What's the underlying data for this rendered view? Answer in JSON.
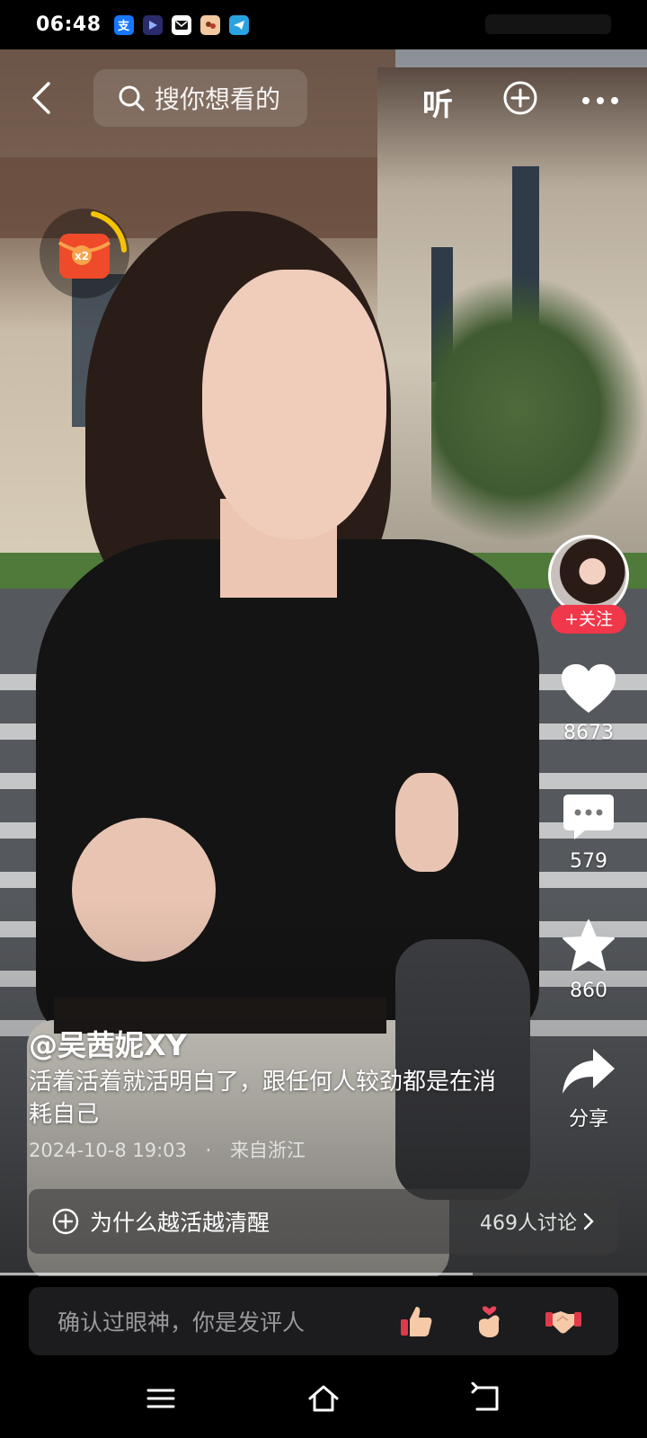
{
  "status_bar": {
    "time": "06:48",
    "app_icons": [
      "alipay-icon",
      "video-app-icon",
      "mail-icon",
      "game-icon",
      "telegram-icon"
    ]
  },
  "toolbar": {
    "search_placeholder": "搜你想看的",
    "listen_label": "听"
  },
  "rail": {
    "follow_label": "+关注",
    "like_count": "8673",
    "comment_count": "579",
    "favorite_count": "860",
    "share_label": "分享"
  },
  "post": {
    "author": "@吴茜妮XY",
    "caption": "活着活着就活明白了，跟任何人较劲都是在消耗自己",
    "date": "2024-10-8 19:03",
    "separator": "·",
    "location": "来自浙江"
  },
  "topic": {
    "title": "为什么越活越清醒",
    "count": "469人讨论"
  },
  "comment": {
    "placeholder": "确认过眼神，你是发评人"
  },
  "playback_progress": 0.73,
  "colors": {
    "follow_red": "#f1374a",
    "packet_red": "#ef4a2a",
    "ring_yellow": "#f5c400"
  }
}
